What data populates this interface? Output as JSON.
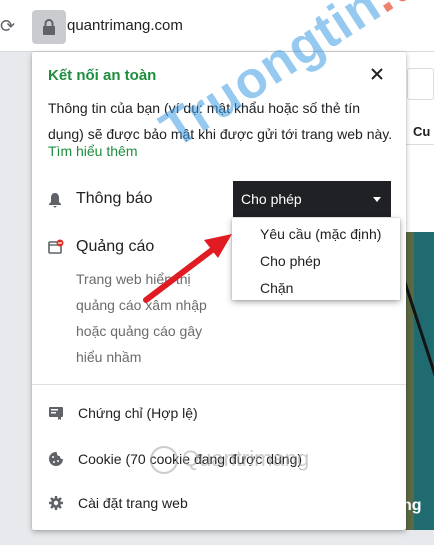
{
  "browser": {
    "url": "quantrimang.com"
  },
  "popup": {
    "title": "Kết nối an toàn",
    "description": "Thông tin của bạn (ví dụ: mật khẩu hoặc số thẻ tín dụng) sẽ được bảo mật khi được gửi tới trang web này.",
    "learn_more": "Tìm hiểu thêm",
    "notifications": {
      "label": "Thông báo",
      "selected": "Cho phép"
    },
    "ads": {
      "label": "Quảng cáo",
      "description": "Trang web hiển thị quảng cáo xâm nhập hoặc quảng cáo gây hiểu nhầm"
    },
    "footer": [
      {
        "label": "Chứng chỉ (Hợp lệ)",
        "icon": "certificate-icon"
      },
      {
        "label": "Cookie (70 cookie đang được dùng)",
        "icon": "cookie-icon"
      },
      {
        "label": "Cài đặt trang web",
        "icon": "gear-icon"
      }
    ]
  },
  "dropdown": {
    "options": [
      "Yêu cầu (mặc định)",
      "Cho phép",
      "Chặn"
    ]
  },
  "background_page": {
    "partial_tab": "Cu",
    "partial_text": "ng"
  },
  "watermark": {
    "text": "Truongtin",
    "dot": ".top",
    "secondary": "Quantrimang"
  },
  "colors": {
    "secure_green": "#1e8e3e",
    "select_bg": "#202124",
    "arrow_red": "#e01b22"
  }
}
